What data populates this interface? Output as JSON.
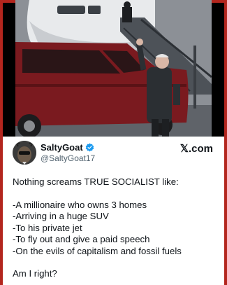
{
  "tweet": {
    "display_name": "SaltyGoat",
    "handle": "@SaltyGoat17",
    "brand": "𝕏.com",
    "headline": "Nothing screams TRUE SOCIALIST like:",
    "bullets": [
      "-A millionaire who owns 3 homes",
      "-Arriving in a huge SUV",
      "-To his private jet",
      "-To fly out and give a paid speech",
      "-On the evils of capitalism and fossil fuels"
    ],
    "closing": "Am I right?"
  },
  "colors": {
    "frame": "#b3261e",
    "verified": "#1d9bf0",
    "suv": "#7a1a1f"
  },
  "icons": {
    "verified": "verified-badge-icon",
    "avatar": "goat-avatar"
  }
}
